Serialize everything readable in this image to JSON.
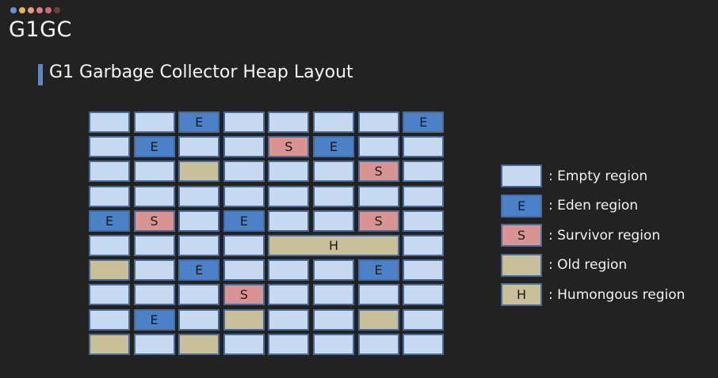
{
  "header": {
    "dots": [
      "#6a8fd6",
      "#e6b45c",
      "#e89a7d",
      "#d97c8c",
      "#cf6a7a",
      "#6b3e3e"
    ],
    "title": "G1GC",
    "heading": "G1 Garbage Collector Heap Layout"
  },
  "colors": {
    "empty": "#c7daf1",
    "eden": "#4b81c8",
    "survivor": "#d99393",
    "old": "#c9bf98",
    "humongous": "#c9bf98"
  },
  "heap": {
    "columns": 8,
    "rows": 10,
    "regions": [
      {
        "row": 1,
        "col": 1,
        "span": 1,
        "type": "empty",
        "label": ""
      },
      {
        "row": 1,
        "col": 2,
        "span": 1,
        "type": "empty",
        "label": ""
      },
      {
        "row": 1,
        "col": 3,
        "span": 1,
        "type": "eden",
        "label": "E"
      },
      {
        "row": 1,
        "col": 4,
        "span": 1,
        "type": "empty",
        "label": ""
      },
      {
        "row": 1,
        "col": 5,
        "span": 1,
        "type": "empty",
        "label": ""
      },
      {
        "row": 1,
        "col": 6,
        "span": 1,
        "type": "empty",
        "label": ""
      },
      {
        "row": 1,
        "col": 7,
        "span": 1,
        "type": "empty",
        "label": ""
      },
      {
        "row": 1,
        "col": 8,
        "span": 1,
        "type": "eden",
        "label": "E"
      },
      {
        "row": 2,
        "col": 1,
        "span": 1,
        "type": "empty",
        "label": ""
      },
      {
        "row": 2,
        "col": 2,
        "span": 1,
        "type": "eden",
        "label": "E"
      },
      {
        "row": 2,
        "col": 3,
        "span": 1,
        "type": "empty",
        "label": ""
      },
      {
        "row": 2,
        "col": 4,
        "span": 1,
        "type": "empty",
        "label": ""
      },
      {
        "row": 2,
        "col": 5,
        "span": 1,
        "type": "survivor",
        "label": "S"
      },
      {
        "row": 2,
        "col": 6,
        "span": 1,
        "type": "eden",
        "label": "E"
      },
      {
        "row": 2,
        "col": 7,
        "span": 1,
        "type": "empty",
        "label": ""
      },
      {
        "row": 2,
        "col": 8,
        "span": 1,
        "type": "empty",
        "label": ""
      },
      {
        "row": 3,
        "col": 1,
        "span": 1,
        "type": "empty",
        "label": ""
      },
      {
        "row": 3,
        "col": 2,
        "span": 1,
        "type": "empty",
        "label": ""
      },
      {
        "row": 3,
        "col": 3,
        "span": 1,
        "type": "old",
        "label": ""
      },
      {
        "row": 3,
        "col": 4,
        "span": 1,
        "type": "empty",
        "label": ""
      },
      {
        "row": 3,
        "col": 5,
        "span": 1,
        "type": "empty",
        "label": ""
      },
      {
        "row": 3,
        "col": 6,
        "span": 1,
        "type": "empty",
        "label": ""
      },
      {
        "row": 3,
        "col": 7,
        "span": 1,
        "type": "survivor",
        "label": "S"
      },
      {
        "row": 3,
        "col": 8,
        "span": 1,
        "type": "empty",
        "label": ""
      },
      {
        "row": 4,
        "col": 1,
        "span": 1,
        "type": "empty",
        "label": ""
      },
      {
        "row": 4,
        "col": 2,
        "span": 1,
        "type": "empty",
        "label": ""
      },
      {
        "row": 4,
        "col": 3,
        "span": 1,
        "type": "empty",
        "label": ""
      },
      {
        "row": 4,
        "col": 4,
        "span": 1,
        "type": "empty",
        "label": ""
      },
      {
        "row": 4,
        "col": 5,
        "span": 1,
        "type": "empty",
        "label": ""
      },
      {
        "row": 4,
        "col": 6,
        "span": 1,
        "type": "empty",
        "label": ""
      },
      {
        "row": 4,
        "col": 7,
        "span": 1,
        "type": "empty",
        "label": ""
      },
      {
        "row": 4,
        "col": 8,
        "span": 1,
        "type": "empty",
        "label": ""
      },
      {
        "row": 5,
        "col": 1,
        "span": 1,
        "type": "eden",
        "label": "E"
      },
      {
        "row": 5,
        "col": 2,
        "span": 1,
        "type": "survivor",
        "label": "S"
      },
      {
        "row": 5,
        "col": 3,
        "span": 1,
        "type": "empty",
        "label": ""
      },
      {
        "row": 5,
        "col": 4,
        "span": 1,
        "type": "eden",
        "label": "E"
      },
      {
        "row": 5,
        "col": 5,
        "span": 1,
        "type": "empty",
        "label": ""
      },
      {
        "row": 5,
        "col": 6,
        "span": 1,
        "type": "empty",
        "label": ""
      },
      {
        "row": 5,
        "col": 7,
        "span": 1,
        "type": "survivor",
        "label": "S"
      },
      {
        "row": 5,
        "col": 8,
        "span": 1,
        "type": "empty",
        "label": ""
      },
      {
        "row": 6,
        "col": 1,
        "span": 1,
        "type": "empty",
        "label": ""
      },
      {
        "row": 6,
        "col": 2,
        "span": 1,
        "type": "empty",
        "label": ""
      },
      {
        "row": 6,
        "col": 3,
        "span": 1,
        "type": "empty",
        "label": ""
      },
      {
        "row": 6,
        "col": 4,
        "span": 1,
        "type": "empty",
        "label": ""
      },
      {
        "row": 6,
        "col": 5,
        "span": 3,
        "type": "humongous",
        "label": "H"
      },
      {
        "row": 6,
        "col": 8,
        "span": 1,
        "type": "empty",
        "label": ""
      },
      {
        "row": 7,
        "col": 1,
        "span": 1,
        "type": "old",
        "label": ""
      },
      {
        "row": 7,
        "col": 2,
        "span": 1,
        "type": "empty",
        "label": ""
      },
      {
        "row": 7,
        "col": 3,
        "span": 1,
        "type": "eden",
        "label": "E"
      },
      {
        "row": 7,
        "col": 4,
        "span": 1,
        "type": "empty",
        "label": ""
      },
      {
        "row": 7,
        "col": 5,
        "span": 1,
        "type": "empty",
        "label": ""
      },
      {
        "row": 7,
        "col": 6,
        "span": 1,
        "type": "empty",
        "label": ""
      },
      {
        "row": 7,
        "col": 7,
        "span": 1,
        "type": "eden",
        "label": "E"
      },
      {
        "row": 7,
        "col": 8,
        "span": 1,
        "type": "empty",
        "label": ""
      },
      {
        "row": 8,
        "col": 1,
        "span": 1,
        "type": "empty",
        "label": ""
      },
      {
        "row": 8,
        "col": 2,
        "span": 1,
        "type": "empty",
        "label": ""
      },
      {
        "row": 8,
        "col": 3,
        "span": 1,
        "type": "empty",
        "label": ""
      },
      {
        "row": 8,
        "col": 4,
        "span": 1,
        "type": "survivor",
        "label": "S"
      },
      {
        "row": 8,
        "col": 5,
        "span": 1,
        "type": "empty",
        "label": ""
      },
      {
        "row": 8,
        "col": 6,
        "span": 1,
        "type": "empty",
        "label": ""
      },
      {
        "row": 8,
        "col": 7,
        "span": 1,
        "type": "empty",
        "label": ""
      },
      {
        "row": 8,
        "col": 8,
        "span": 1,
        "type": "empty",
        "label": ""
      },
      {
        "row": 9,
        "col": 1,
        "span": 1,
        "type": "empty",
        "label": ""
      },
      {
        "row": 9,
        "col": 2,
        "span": 1,
        "type": "eden",
        "label": "E"
      },
      {
        "row": 9,
        "col": 3,
        "span": 1,
        "type": "empty",
        "label": ""
      },
      {
        "row": 9,
        "col": 4,
        "span": 1,
        "type": "old",
        "label": ""
      },
      {
        "row": 9,
        "col": 5,
        "span": 1,
        "type": "empty",
        "label": ""
      },
      {
        "row": 9,
        "col": 6,
        "span": 1,
        "type": "empty",
        "label": ""
      },
      {
        "row": 9,
        "col": 7,
        "span": 1,
        "type": "old",
        "label": ""
      },
      {
        "row": 9,
        "col": 8,
        "span": 1,
        "type": "empty",
        "label": ""
      },
      {
        "row": 10,
        "col": 1,
        "span": 1,
        "type": "old",
        "label": ""
      },
      {
        "row": 10,
        "col": 2,
        "span": 1,
        "type": "empty",
        "label": ""
      },
      {
        "row": 10,
        "col": 3,
        "span": 1,
        "type": "old",
        "label": ""
      },
      {
        "row": 10,
        "col": 4,
        "span": 1,
        "type": "empty",
        "label": ""
      },
      {
        "row": 10,
        "col": 5,
        "span": 1,
        "type": "empty",
        "label": ""
      },
      {
        "row": 10,
        "col": 6,
        "span": 1,
        "type": "empty",
        "label": ""
      },
      {
        "row": 10,
        "col": 7,
        "span": 1,
        "type": "empty",
        "label": ""
      },
      {
        "row": 10,
        "col": 8,
        "span": 1,
        "type": "empty",
        "label": ""
      }
    ]
  },
  "legend": [
    {
      "type": "empty",
      "swatch_label": "",
      "label": ": Empty region"
    },
    {
      "type": "eden",
      "swatch_label": "E",
      "label": ": Eden region"
    },
    {
      "type": "survivor",
      "swatch_label": "S",
      "label": ": Survivor region"
    },
    {
      "type": "old",
      "swatch_label": "",
      "label": ": Old region"
    },
    {
      "type": "humongous",
      "swatch_label": "H",
      "label": ": Humongous region"
    }
  ]
}
